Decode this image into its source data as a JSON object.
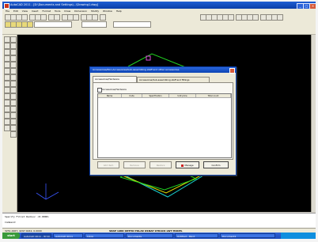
{
  "window": {
    "title": "AutoCAD 2011 - [D:\\Documents and Settings\\...\\Drawing1.dwg]"
  },
  "menubar": [
    "File",
    "Edit",
    "View",
    "Insert",
    "Format",
    "Tools",
    "Draw",
    "Dimension",
    "Modify",
    "Window",
    "Help"
  ],
  "dialog": {
    "title": "Accessoires/Non-Accessoires/Sub-assembling staff and other accessories",
    "tabs": [
      "Accessories/Hardware",
      "Accessories/Sub-assembling staff and fittings"
    ],
    "checkbox_label": "Accessories/Hardware",
    "columns": [
      "Name",
      "Code",
      "Specification",
      "Unit price",
      "Total count"
    ],
    "buttons": [
      "Add item",
      "Remove",
      "Restore",
      "Manage",
      "Confirm"
    ]
  },
  "command": {
    "line1": "Specify Fillet Radius: <0.0000>",
    "line2": "Command:"
  },
  "status": {
    "coords": "3251.4467, 4297.0242, 0.0000",
    "modes": "SNAP GRID ORTHO POLAR OSNAP OTRACK LWT MODEL"
  },
  "taskbar": {
    "start": "start",
    "items": [
      "AutoCAD 2011 - [D:\\D...",
      "AutoCAD 2011",
      "Inbox",
      "Documents",
      "Untitled - Paint",
      "Document1"
    ]
  },
  "colors": {
    "canvas": "#000000",
    "titlebar": "#0a3ea8",
    "dialog": "#ece9d8",
    "wire_cyan": "#19d1d1",
    "wire_green": "#20d020",
    "wire_magenta": "#e04be0",
    "wire_yellow": "#e5e000",
    "axis_blue": "#3a56ff"
  }
}
